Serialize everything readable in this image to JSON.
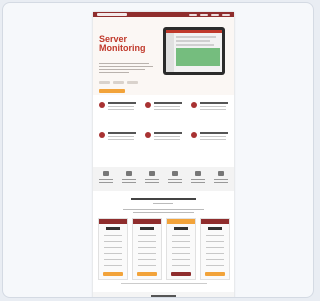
{
  "page": {
    "brand": "",
    "hero": {
      "title_line1": "Server",
      "title_line2": "Monitoring",
      "subtitle": ""
    }
  },
  "colors": {
    "brand_red": "#8f2d2d",
    "accent_orange": "#f2a33a",
    "hero_title": "#c0392b",
    "chart_green": "#5fb46a"
  },
  "icons": {
    "feature_icon": "circle-feature-icon",
    "stat_icon": "stat-icon"
  }
}
